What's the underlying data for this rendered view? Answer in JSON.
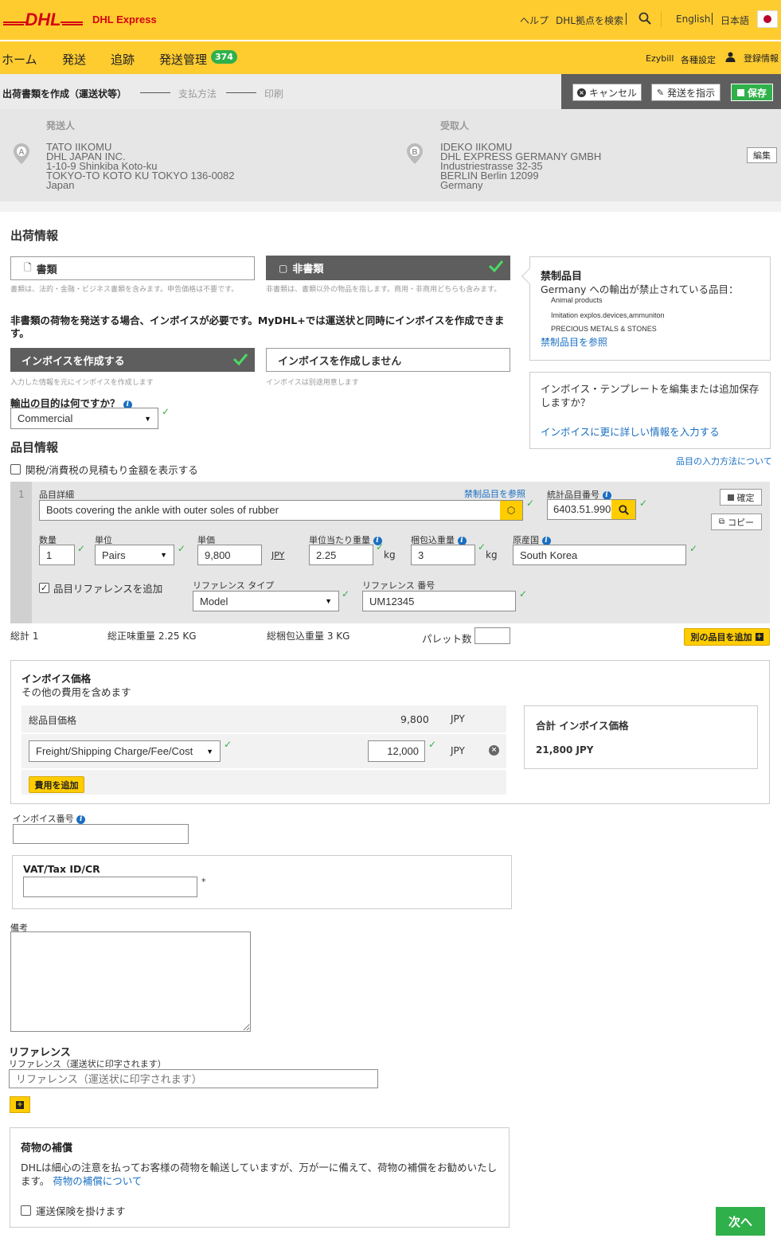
{
  "header": {
    "logo_text": "DHL",
    "brand": "DHL Express",
    "links": [
      "ヘルプ",
      "DHL拠点を検索"
    ],
    "lang_en": "English",
    "lang_ja": "日本語"
  },
  "nav": {
    "items": [
      "ホーム",
      "発送",
      "追跡",
      "発送管理"
    ],
    "badge": "374",
    "right": [
      "Ezybill",
      "各種設定",
      "登録情報"
    ]
  },
  "steps": {
    "current": "出荷書類を作成（運送状等）",
    "step2": "支払方法",
    "step3": "印刷",
    "cancel": "キャンセル",
    "instruct": "発送を指示",
    "save": "保存"
  },
  "shipper": {
    "heading": "発送人",
    "pin": "A",
    "lines": [
      "TATO IIKOMU",
      "DHL JAPAN INC.",
      "1-10-9 Shinkiba Koto-ku",
      "TOKYO-TO KOTO KU TOKYO 136-0082",
      "Japan"
    ]
  },
  "receiver": {
    "heading": "受取人",
    "pin": "B",
    "lines": [
      "IDEKO IIKOMU",
      "DHL EXPRESS GERMANY GMBH",
      "Industriestrasse 32-35",
      "BERLIN Berlin 12099",
      "Germany"
    ],
    "edit": "編集"
  },
  "shipment": {
    "heading": "出荷情報",
    "doc_label": "書類",
    "doc_desc": "書類は、法的・金融・ビジネス書類を含みます。申告価格は不要です。",
    "nondoc_label": "非書類",
    "nondoc_desc": "非書類は、書類以外の物品を指します。商用・非商用どちらも含みます。",
    "invoice_notice": "非書類の荷物を発送する場合、インボイスが必要です。MyDHL+では運送状と同時にインボイスを作成できます。",
    "create_invoice": "インボイスを作成する",
    "create_invoice_desc": "入力した情報を元にインボイスを作成します",
    "no_invoice": "インボイスを作成しません",
    "no_invoice_desc": "インボイスは別途用意します",
    "purpose_label": "輸出の目的は何ですか？",
    "purpose_value": "Commercial"
  },
  "restricted": {
    "title": "禁制品目",
    "subtitle": "Germany への輸出が禁止されている品目：",
    "items": [
      "Animal products",
      "Imitation explos.devices,ammuniton",
      "PRECIOUS METALS & STONES"
    ],
    "link": "禁制品目を参照"
  },
  "template_box": {
    "text": "インボイス・テンプレートを編集または追加保存しますか？",
    "link": "インボイスに更に詳しい情報を入力する"
  },
  "items_section": {
    "heading": "品目情報",
    "duty_estimate": "関税/消費税の見積もり金額を表示する",
    "how_to_link": "品目の入力方法について"
  },
  "item": {
    "index": "1",
    "desc_label": "品目詳細",
    "restricted_link": "禁制品目を参照",
    "desc_value": "Boots covering the ankle with outer soles of rubber",
    "hs_label": "統計品目番号",
    "hs_value": "6403.51.990",
    "confirm": "確定",
    "copy": "コピー",
    "qty_label": "数量",
    "qty_value": "1",
    "unit_label": "単位",
    "unit_value": "Pairs",
    "price_label": "単価",
    "price_value": "9,800",
    "currency": "JPY",
    "net_label": "単位当たり重量",
    "net_value": "2.25",
    "gross_label": "梱包込重量",
    "gross_value": "3",
    "kg": "kg",
    "origin_label": "原産国",
    "origin_value": "South Korea",
    "ref_check": "品目リファレンスを追加",
    "ref_type_label": "リファレンス タイプ",
    "ref_type_value": "Model",
    "ref_no_label": "リファレンス 番号",
    "ref_no_value": "UM12345"
  },
  "totals": {
    "total": "総計 1",
    "net": "総正味重量 2.25 KG",
    "gross": "総梱包込重量 3 KG",
    "pallets": "パレット数",
    "add_item": "別の品目を追加"
  },
  "invoice_value": {
    "title": "インボイス価格",
    "subtitle": "その他の費用を含めます",
    "items_total_label": "総品目価格",
    "items_total": "9,800",
    "currency": "JPY",
    "charge_type": "Freight/Shipping Charge/Fee/Cost",
    "charge_value": "12,000",
    "add_charge": "費用を追加",
    "grand_label": "合計 インボイス価格",
    "grand_value": "21,800 JPY"
  },
  "invoice_no_label": "インボイス番号",
  "vat_label": "VAT/Tax ID/CR",
  "remarks_label": "備考",
  "reference": {
    "heading": "リファレンス",
    "sub": "リファレンス（運送状に印字されます）",
    "placeholder": "リファレンス（運送状に印字されます）"
  },
  "insurance": {
    "title": "荷物の補償",
    "text": "DHLは細心の注意を払ってお客様の荷物を輸送していますが、万が一に備えて、荷物の補償をお勧めいたします。",
    "link": "荷物の補償について",
    "check": "運送保険を掛けます"
  },
  "next": "次へ",
  "colors": {
    "dhl_yellow": "#ffcc30",
    "dhl_red": "#d40511",
    "green": "#2fb04a",
    "link": "#1a6fc2"
  }
}
